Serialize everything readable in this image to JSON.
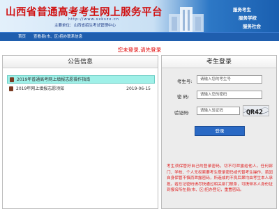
{
  "header": {
    "title": "山西省普通高考考生网上服务平台",
    "url": "http://www.sxkszx.cn",
    "host_label": "主要单位：山西省招生考试管理中心",
    "slogans": [
      "服务考生",
      "服务学校",
      "服务社会"
    ],
    "colors": {
      "title": "#d01212",
      "banner_dark": "#1a5fb0"
    }
  },
  "nav": {
    "items": [
      "首页",
      "查看县(市、区)招办联系信息"
    ]
  },
  "login_notice": "您未登录,请先登录",
  "announcements": {
    "title": "公告信息",
    "items": [
      {
        "text": "2019年普通高考网上填报志愿操作指南",
        "date": "",
        "highlighted": true,
        "icon": "document-icon"
      },
      {
        "text": "2019年网上填报志愿须知",
        "date": "2019-06-15",
        "highlighted": false,
        "icon": "document-icon"
      }
    ]
  },
  "login": {
    "title": "考生登录",
    "fields": [
      {
        "label": "考生号:",
        "placeholder": "请输入您的考生号"
      },
      {
        "label": "密  码:",
        "placeholder": "请输入您的密码"
      },
      {
        "label": "验证码:",
        "placeholder": "请输入验证码"
      }
    ],
    "captcha_text": "QR42",
    "button": "登录",
    "warning": "考生须保管好自己的登录密码，切不可泄露给他人。任何部门、学校、个人无权索要考生登录密码或代替考生操作，若因自身保管不慎而泄露密码，所造成的不良后果均由考生本人承担。若忘记密码请尽快通过相关部门联系，可携带本人身份证到报名所在县(市、区)招办登记，重置密码。"
  }
}
